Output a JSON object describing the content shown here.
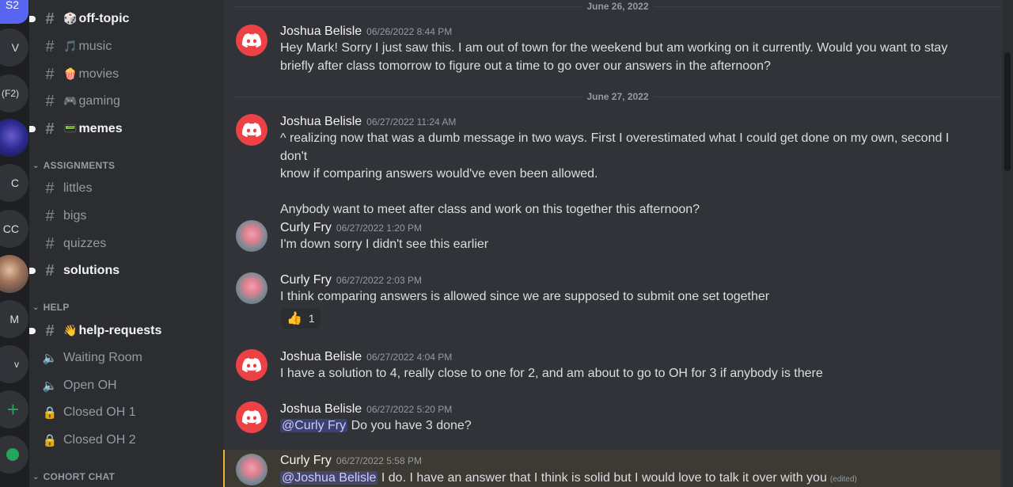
{
  "servers": [
    {
      "label": "S2",
      "active": true
    },
    {
      "label": "V"
    },
    {
      "label": "(F2)"
    },
    {
      "label": ""
    },
    {
      "label": "C"
    },
    {
      "label": "CC"
    },
    {
      "label": ""
    },
    {
      "label": "M"
    },
    {
      "label": "v"
    },
    {
      "label": "+"
    },
    {
      "label": ""
    }
  ],
  "channels": {
    "items": [
      {
        "name": "off-topic",
        "emoji": "🎲",
        "unread": true
      },
      {
        "name": "music",
        "emoji": "🎵"
      },
      {
        "name": "movies",
        "emoji": "🍿"
      },
      {
        "name": "gaming",
        "emoji": "🎮"
      },
      {
        "name": "memes",
        "emoji": "📟",
        "unread": true
      }
    ],
    "categories": {
      "assignments": "ASSIGNMENTS",
      "help": "HELP",
      "cohort": "COHORT CHAT"
    },
    "assignments": [
      {
        "name": "littles"
      },
      {
        "name": "bigs"
      },
      {
        "name": "quizzes"
      },
      {
        "name": "solutions",
        "unread": true
      }
    ],
    "help": [
      {
        "name": "help-requests",
        "emoji": "👋",
        "unread": true
      },
      {
        "name": "Waiting Room"
      },
      {
        "name": "Open OH"
      },
      {
        "name": "Closed OH 1"
      },
      {
        "name": "Closed OH 2"
      }
    ]
  },
  "chat": {
    "dividers": [
      "June 26, 2022",
      "June 27, 2022"
    ],
    "messages": [
      {
        "author": "Joshua Belisle",
        "time": "06/26/2022 8:44 PM",
        "lines": [
          "Hey Mark! Sorry I just saw this. I am out of town for the weekend but am working on it currently. Would you want to stay",
          "briefly after class tomorrow to figure out a time to go over our answers in the afternoon?"
        ]
      },
      {
        "author": "Joshua Belisle",
        "time": "06/27/2022 11:24 AM",
        "lines": [
          "^ realizing now that was a dumb message in two ways. First I overestimated what I could get done on my own, second I don't",
          "know if comparing answers would've even been allowed.",
          "",
          "Anybody want to meet after class and work on this together this afternoon?"
        ]
      },
      {
        "author": "Curly Fry",
        "time": "06/27/2022 1:20 PM",
        "lines": [
          "I'm down sorry I didn't see this earlier"
        ]
      },
      {
        "author": "Curly Fry",
        "time": "06/27/2022 2:03 PM",
        "lines": [
          "I think comparing answers is allowed since we are supposed to submit one set together"
        ],
        "reaction": {
          "emoji": "👍",
          "count": "1"
        }
      },
      {
        "author": "Joshua Belisle",
        "time": "06/27/2022 4:04 PM",
        "lines": [
          "I have a solution to 4, really close to one for 2, and am about to go to OH for 3 if anybody is there"
        ]
      },
      {
        "author": "Joshua Belisle",
        "time": "06/27/2022 5:20 PM",
        "mention": "@Curly Fry",
        "text": "Do you have 3 done?"
      },
      {
        "author": "Curly Fry",
        "time": "06/27/2022 5:58 PM",
        "mention": "@Joshua Belisle",
        "text": "I do. I have an answer that I think is solid but I would love to talk it over with you",
        "edited": "(edited)"
      }
    ]
  },
  "colors": {
    "accent": "#5865f2",
    "discord_red": "#ed4245",
    "highlight": "#f0b232"
  }
}
